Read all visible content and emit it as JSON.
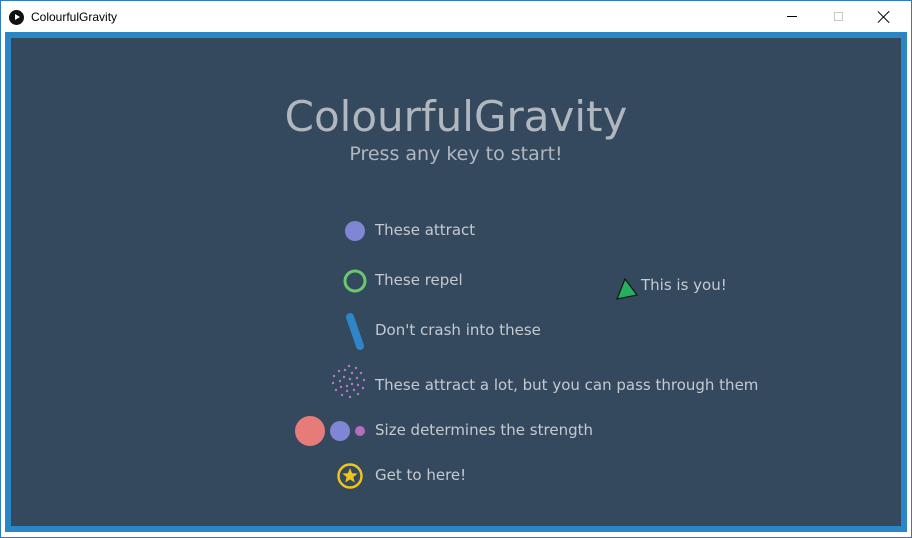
{
  "window": {
    "title": "ColourfulGravity",
    "controls": [
      "minimize",
      "maximize",
      "close"
    ]
  },
  "game": {
    "title": "ColourfulGravity",
    "subtitle": "Press any key to start!",
    "legend": [
      {
        "icon": "attractor-icon",
        "label": "These attract"
      },
      {
        "icon": "repeller-icon",
        "label": "These repel"
      },
      {
        "icon": "wall-icon",
        "label": "Don't crash into these"
      },
      {
        "icon": "vortex-icon",
        "label": "These attract a lot, but you can pass through them"
      },
      {
        "icon": "size-circles-icon",
        "label": "Size determines the strength"
      },
      {
        "icon": "star-goal-icon",
        "label": "Get to here!"
      }
    ],
    "player_label": "This is you!"
  },
  "colors": {
    "background": "#34495e",
    "border": "#2b86c6",
    "attractor": "#7f86d3",
    "repeller": "#6cc86c",
    "wall": "#2e86c8",
    "vortex": "#b77bc2",
    "large_circle": "#e77b79",
    "small_circle": "#b66dc0",
    "goal": "#f0c419",
    "player": "#27ae60"
  }
}
